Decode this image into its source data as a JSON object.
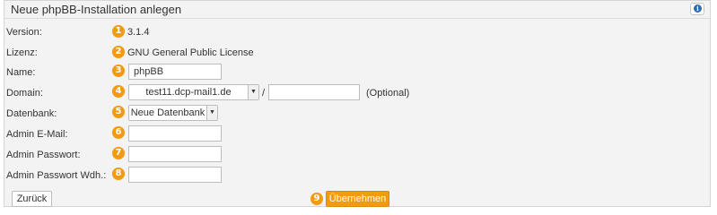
{
  "header": {
    "title": "Neue phpBB-Installation anlegen",
    "info_icon": "info-icon"
  },
  "fields": {
    "version": {
      "label": "Version:",
      "badge": "1",
      "value": "3.1.4"
    },
    "license": {
      "label": "Lizenz:",
      "badge": "2",
      "value": "GNU General Public License"
    },
    "name": {
      "label": "Name:",
      "badge": "3",
      "value": "phpBB"
    },
    "domain": {
      "label": "Domain:",
      "badge": "4",
      "selected": "test11.dcp-mail1.de",
      "separator": "/",
      "path_value": "",
      "optional": "(Optional)"
    },
    "database": {
      "label": "Datenbank:",
      "badge": "5",
      "selected": "Neue Datenbank"
    },
    "admin_email": {
      "label": "Admin E-Mail:",
      "badge": "6",
      "value": ""
    },
    "admin_password": {
      "label": "Admin Passwort:",
      "badge": "7",
      "value": ""
    },
    "admin_password_repeat": {
      "label": "Admin Passwort Wdh.:",
      "badge": "8",
      "value": ""
    }
  },
  "actions": {
    "back_label": "Zurück",
    "apply_badge": "9",
    "apply_label": "Übernehmen"
  },
  "colors": {
    "accent": "#f29a10",
    "panel_bg": "#f3f3f3",
    "info_blue": "#2a6db3"
  }
}
